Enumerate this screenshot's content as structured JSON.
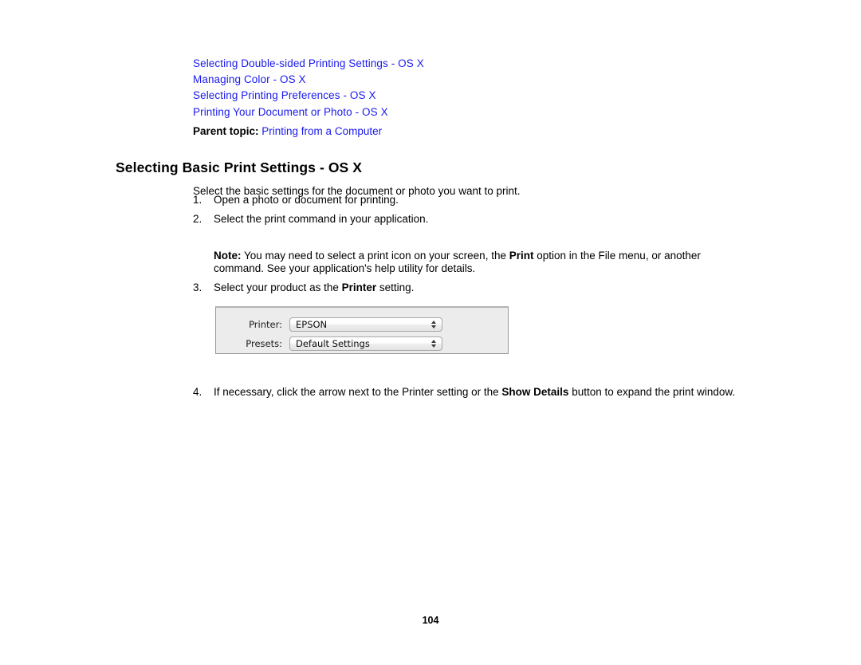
{
  "document": {
    "related_links": [
      {
        "label": "Selecting Double-sided Printing Settings - OS X"
      },
      {
        "label": "Managing Color - OS X"
      },
      {
        "label": "Selecting Printing Preferences - OS X"
      },
      {
        "label": "Printing Your Document or Photo - OS X"
      }
    ],
    "parent_topic": {
      "label": "Parent topic:",
      "link": "Printing from a Computer"
    },
    "heading": "Selecting Basic Print Settings - OS X",
    "intro": "Select the basic settings for the document or photo you want to print.",
    "steps": [
      {
        "number": "1.",
        "text": "Open a photo or document for printing."
      },
      {
        "number": "2.",
        "text": "Select the print command in your application."
      }
    ],
    "note": {
      "label": "Note:",
      "part1": " You may need to select a print icon on your screen, the ",
      "bold1": "Print",
      "part2": " option in the File menu, or another command. See your application's help utility for details."
    },
    "step3": {
      "number": "3.",
      "part1": "Select your product as the ",
      "bold1": "Printer",
      "part2": " setting."
    },
    "step4": {
      "number": "4.",
      "part1": "If necessary, click the arrow next to the Printer setting or the ",
      "bold1": "Show Details",
      "part2": " button to expand the print window."
    },
    "page_number": "104"
  },
  "print_dialog": {
    "rows": [
      {
        "label": "Printer:",
        "value": "EPSON"
      },
      {
        "label": "Presets:",
        "value": "Default Settings"
      }
    ]
  },
  "colors": {
    "link": "#1a1aee",
    "dialog_background": "#ececec",
    "text": "#000000"
  }
}
